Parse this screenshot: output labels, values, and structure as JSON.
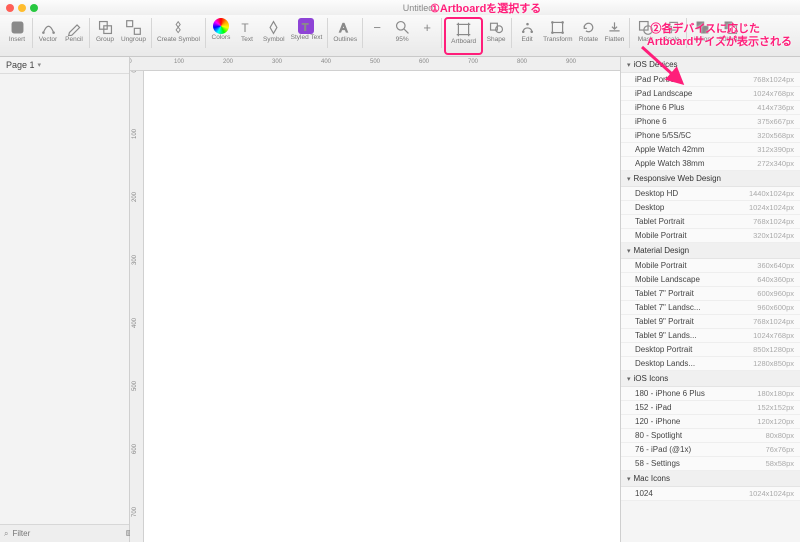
{
  "title": "Untitled",
  "annotations": {
    "a1": "①Artboardを選択する",
    "a2a": "②各デバイスに応じた",
    "a2b": "Artboardサイズが表示される"
  },
  "pages": {
    "current": "Page 1"
  },
  "filter": {
    "placeholder": "Filter"
  },
  "zoom": "95%",
  "toolbar": [
    {
      "k": "insert",
      "label": "Insert"
    },
    {
      "k": "vector",
      "label": "Vector"
    },
    {
      "k": "pencil",
      "label": "Pencil"
    },
    {
      "k": "group",
      "label": "Group"
    },
    {
      "k": "ungroup",
      "label": "Ungroup"
    },
    {
      "k": "create-symbol",
      "label": "Create Symbol"
    },
    {
      "k": "colors",
      "label": "Colors"
    },
    {
      "k": "text",
      "label": "Text"
    },
    {
      "k": "symbol",
      "label": "Symbol"
    },
    {
      "k": "styled-text",
      "label": "Styled Text"
    },
    {
      "k": "outlines",
      "label": "Outlines"
    },
    {
      "k": "zoom-out",
      "label": "-"
    },
    {
      "k": "zoom",
      "label": "95%"
    },
    {
      "k": "zoom-in",
      "label": "+"
    },
    {
      "k": "artboard",
      "label": "Artboard"
    },
    {
      "k": "shape",
      "label": "Shape"
    },
    {
      "k": "edit",
      "label": "Edit"
    },
    {
      "k": "transform",
      "label": "Transform"
    },
    {
      "k": "rotate",
      "label": "Rotate"
    },
    {
      "k": "flatten",
      "label": "Flatten"
    },
    {
      "k": "mask",
      "label": "Mask"
    },
    {
      "k": "scale",
      "label": "Scale"
    },
    {
      "k": "union",
      "label": "Union"
    },
    {
      "k": "subtract",
      "label": "Subtract"
    }
  ],
  "hruler": [
    0,
    100,
    200,
    300,
    400,
    500,
    600,
    700,
    800,
    900
  ],
  "vruler": [
    0,
    100,
    200,
    300,
    400,
    500,
    600,
    700
  ],
  "inspector": [
    {
      "header": "iOS Devices",
      "items": [
        {
          "n": "iPad Portrait",
          "s": "768x1024px"
        },
        {
          "n": "iPad Landscape",
          "s": "1024x768px"
        },
        {
          "n": "iPhone 6 Plus",
          "s": "414x736px"
        },
        {
          "n": "iPhone 6",
          "s": "375x667px"
        },
        {
          "n": "iPhone 5/5S/5C",
          "s": "320x568px"
        },
        {
          "n": "Apple Watch 42mm",
          "s": "312x390px"
        },
        {
          "n": "Apple Watch 38mm",
          "s": "272x340px"
        }
      ]
    },
    {
      "header": "Responsive Web Design",
      "items": [
        {
          "n": "Desktop HD",
          "s": "1440x1024px"
        },
        {
          "n": "Desktop",
          "s": "1024x1024px"
        },
        {
          "n": "Tablet Portrait",
          "s": "768x1024px"
        },
        {
          "n": "Mobile Portrait",
          "s": "320x1024px"
        }
      ]
    },
    {
      "header": "Material Design",
      "items": [
        {
          "n": "Mobile Portrait",
          "s": "360x640px"
        },
        {
          "n": "Mobile Landscape",
          "s": "640x360px"
        },
        {
          "n": "Tablet 7\" Portrait",
          "s": "600x960px"
        },
        {
          "n": "Tablet 7\" Landsc...",
          "s": "960x600px"
        },
        {
          "n": "Tablet 9\" Portrait",
          "s": "768x1024px"
        },
        {
          "n": "Tablet 9\" Lands...",
          "s": "1024x768px"
        },
        {
          "n": "Desktop Portrait",
          "s": "850x1280px"
        },
        {
          "n": "Desktop Lands...",
          "s": "1280x850px"
        }
      ]
    },
    {
      "header": "iOS Icons",
      "items": [
        {
          "n": "180 - iPhone 6 Plus",
          "s": "180x180px"
        },
        {
          "n": "152 - iPad",
          "s": "152x152px"
        },
        {
          "n": "120 - iPhone",
          "s": "120x120px"
        },
        {
          "n": "80 - Spotlight",
          "s": "80x80px"
        },
        {
          "n": "76 - iPad (@1x)",
          "s": "76x76px"
        },
        {
          "n": "58 - Settings",
          "s": "58x58px"
        }
      ]
    },
    {
      "header": "Mac Icons",
      "items": [
        {
          "n": "1024",
          "s": "1024x1024px"
        }
      ]
    }
  ]
}
